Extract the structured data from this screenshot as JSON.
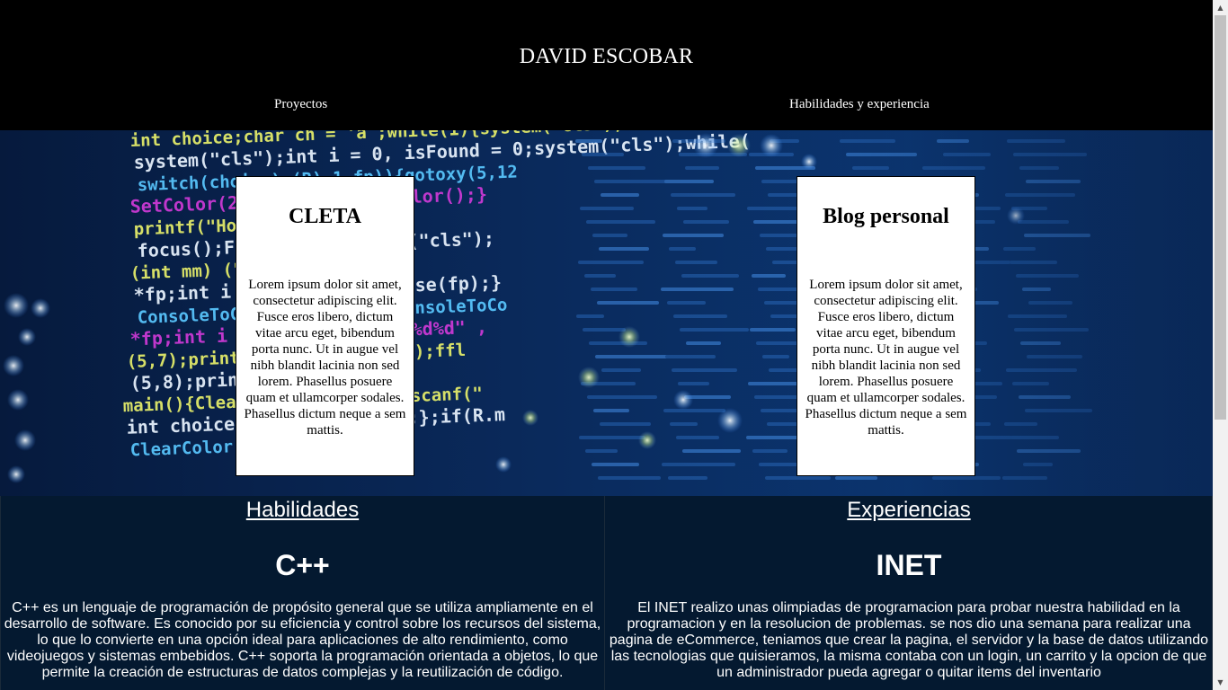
{
  "header": {
    "title": "DAVID ESCOBAR",
    "nav": {
      "proyectos": "Proyectos",
      "habilidades": "Habilidades y experiencia"
    }
  },
  "hero": {
    "background_image": "code-on-screen-photo",
    "code_lines": [
      "int choice;char ch = 'a';while(1){system(\"cls\");scanf(",
      "system(\"cls\");int i = 0, isFound = 0;system(\"cls\");while(",
      "switch(choice)   (R),1,fp)){gotoxy(5,12",
      "SetColor(25)     !\\a\");ClearColor();}",
      "printf(\"Home     }",
      "focus();FILE     d = 0;system(\"cls\");",
      "(int mm)         (\"cls\");",
      "*fp;int i =      ose(fp);};fclose(fp);}",
      "ConsoleToCol     \"cls\");ClearConsoleToCo",
      "*fp;int i =      M): \");scanf(\"%d%d\" ,",
      "(5,7);print      haracter max): \");ffl",
      "(5,8);print",
      "main(){ClearC    system(\"cls\");scanf(\"",
      "int choice;ch    );fclose(fp);};if(R.m",
      "ClearColor()"
    ],
    "cards": [
      {
        "title": "CLETA",
        "text": "Lorem ipsum dolor sit amet, consectetur adipiscing elit. Fusce eros libero, dictum vitae arcu eget, bibendum porta nunc. Ut in augue vel nibh blandit lacinia non sed lorem. Phasellus posuere quam et ullamcorper sodales. Phasellus dictum neque a sem mattis."
      },
      {
        "title": "Blog personal",
        "text": "Lorem ipsum dolor sit amet, consectetur adipiscing elit. Fusce eros libero, dictum vitae arcu eget, bibendum porta nunc. Ut in augue vel nibh blandit lacinia non sed lorem. Phasellus posuere quam et ullamcorper sodales. Phasellus dictum neque a sem mattis."
      }
    ]
  },
  "sections": {
    "habilidades": {
      "heading": "Habilidades",
      "item_title": "C++",
      "item_text": "C++ es un lenguaje de programación de propósito general que se utiliza ampliamente en el desarrollo de software. Es conocido por su eficiencia y control sobre los recursos del sistema, lo que lo convierte en una opción ideal para aplicaciones de alto rendimiento, como videojuegos y sistemas embebidos. C++ soporta la programación orientada a objetos, lo que permite la creación de estructuras de datos complejas y la reutilización de código."
    },
    "experiencias": {
      "heading": "Experiencias",
      "item_title": "INET",
      "item_text": "El INET realizo unas olimpiadas de programacion para probar nuestra habilidad en la programacion y en la resolucion de problemas. se nos dio una semana para realizar una pagina de eCommerce, teniamos que crear la pagina, el servidor y la base de datos utilizando las tecnologias que quisieramos, la misma contaba con un login, un carrito y la opcion de que un administrador pueda agregar o quitar items del inventario"
    }
  },
  "colors": {
    "header_bg": "#000000",
    "bottom_bg": "#041930",
    "card_bg": "#ffffff",
    "code_yellow": "#e8f06a",
    "code_magenta": "#d03ad8",
    "code_cyan": "#5ac8ff",
    "code_white": "#eaf4ff"
  },
  "scrollbar": {
    "up_icon": "scroll-up-arrow-icon",
    "down_icon": "scroll-down-arrow-icon"
  }
}
